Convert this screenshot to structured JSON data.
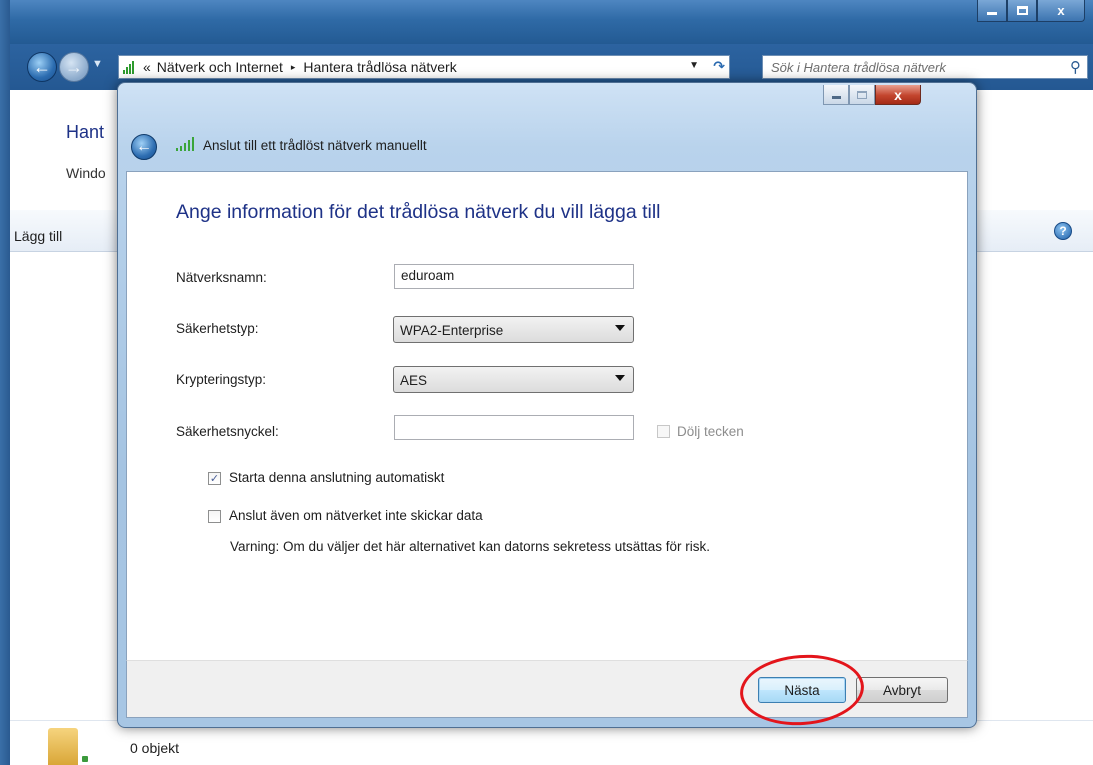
{
  "explorer": {
    "address": {
      "overflow": "«",
      "segment_1": "Nätverk och Internet",
      "separator": "▸",
      "segment_2": "Hantera trådlösa nätverk"
    },
    "search_placeholder": "Sök i Hantera trådlösa nätverk",
    "heading_partial": "Hant",
    "subtext_partial": "Windo",
    "toolbar_label_partial": "Lägg till",
    "status_text": "0 objekt",
    "icons": {
      "back": "back-arrow-icon",
      "forward": "forward-arrow-icon",
      "refresh": "refresh-icon",
      "search": "search-icon",
      "help": "help-icon"
    }
  },
  "dialog": {
    "title": "Anslut till ett trådlöst nätverk manuellt",
    "main_instruction": "Ange information för det trådlösa nätverk du vill lägga till",
    "fields": {
      "network_name_label": "Nätverksnamn:",
      "network_name_value": "eduroam",
      "security_type_label": "Säkerhetstyp:",
      "security_type_value": "WPA2-Enterprise",
      "encryption_type_label": "Krypteringstyp:",
      "encryption_type_value": "AES",
      "security_key_label": "Säkerhetsnyckel:",
      "security_key_value": "",
      "hide_chars_label": "Dölj tecken"
    },
    "options": {
      "auto_start_label": "Starta denna anslutning automatiskt",
      "auto_start_checked": true,
      "connect_even_label": "Anslut även om nätverket inte skickar data",
      "connect_even_checked": false,
      "warning": "Varning: Om du väljer det här alternativet kan datorns sekretess utsättas för risk."
    },
    "buttons": {
      "next": "Nästa",
      "cancel": "Avbryt"
    },
    "close_glyph": "x"
  },
  "colors": {
    "instruction_blue": "#1e3287",
    "highlight_red": "#e3151b",
    "titlebar_blue": "#2f6aa6"
  }
}
